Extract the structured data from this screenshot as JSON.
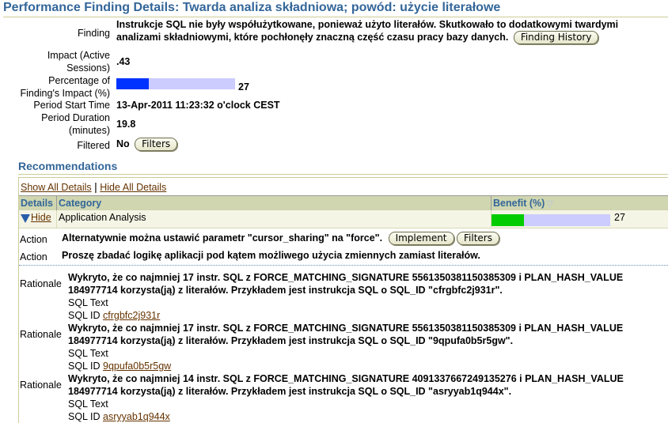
{
  "page": {
    "title": "Performance Finding Details: Twarda analiza składniowa; powód: użycie literałowe"
  },
  "details": {
    "finding_label": "Finding",
    "finding_text_line1": "Instrukcje SQL nie były współużytkowane, ponieważ użyto literałów. Skutkowało to dodatkowymi twardymi",
    "finding_text_line2": "analizami składniowymi, które pochłonęły znaczną część czasu pracy bazy danych.",
    "finding_history_button": "Finding History",
    "impact_label_line1": "Impact (Active",
    "impact_label_line2": "Sessions)",
    "impact_value": ".43",
    "percentage_label_line1": "Percentage of",
    "percentage_label_line2": "Finding's Impact (%)",
    "percentage_value": "27",
    "percentage_fraction": 0.27,
    "percentage_bar_color": "#0033ff",
    "bar_track_color": "#ccccff",
    "period_start_label": "Period Start Time",
    "period_start_value": "13-Apr-2011 11:23:32 o'clock CEST",
    "period_duration_label_line1": "Period Duration",
    "period_duration_label_line2": "(minutes)",
    "period_duration_value": "19.8",
    "filtered_label": "Filtered",
    "filtered_value": "No",
    "filters_button": "Filters"
  },
  "recommendations": {
    "title": "Recommendations",
    "show_all": "Show All Details",
    "separator": "|",
    "hide_all": "Hide All Details",
    "columns": {
      "details": "Details",
      "category": "Category",
      "benefit": "Benefit (%)",
      "benefit_sort_icon": "sort-descending-icon"
    },
    "rows": [
      {
        "toggle_label": "Hide",
        "category": "Application Analysis",
        "benefit": "27",
        "benefit_fraction": 0.27,
        "benefit_bar_color": "#00cc00"
      }
    ],
    "actions": [
      {
        "label": "Action",
        "text": "Alternatywnie można ustawić parametr \"cursor_sharing\" na \"force\".",
        "buttons": [
          "Implement",
          "Filters"
        ]
      },
      {
        "label": "Action",
        "text": "Proszę zbadać logikę aplikacji pod kątem możliwego użycia zmiennych zamiast literałów."
      }
    ],
    "rationales": [
      {
        "label": "Rationale",
        "line1": "Wykryto, że co najmniej 17 instr. SQL z FORCE_MATCHING_SIGNATURE 5561350381150385309 i PLAN_HASH_VALUE",
        "line2": "184977714 korzysta(ją) z literałów. Przykładem jest instrukcja SQL o SQL_ID \"cfrgbfc2j931r\".",
        "sql_text_label": "SQL Text",
        "sql_id_label": "SQL ID",
        "sql_id": "cfrgbfc2j931r"
      },
      {
        "label": "Rationale",
        "line1": "Wykryto, że co najmniej 17 instr. SQL z FORCE_MATCHING_SIGNATURE 5561350381150385309 i PLAN_HASH_VALUE",
        "line2": "184977714 korzysta(ją) z literałów. Przykładem jest instrukcja SQL o SQL_ID \"9qpufa0b5r5gw\".",
        "sql_text_label": "SQL Text",
        "sql_id_label": "SQL ID",
        "sql_id": "9qpufa0b5r5gw"
      },
      {
        "label": "Rationale",
        "line1": "Wykryto, że co najmniej 14 instr. SQL z FORCE_MATCHING_SIGNATURE 4091337667249135276 i PLAN_HASH_VALUE",
        "line2": "184977714 korzysta(ją) z literałów. Przykładem jest instrukcja SQL o SQL_ID \"asryyab1q944x\".",
        "sql_text_label": "SQL Text",
        "sql_id_label": "SQL ID",
        "sql_id": "asryyab1q944x"
      }
    ]
  }
}
